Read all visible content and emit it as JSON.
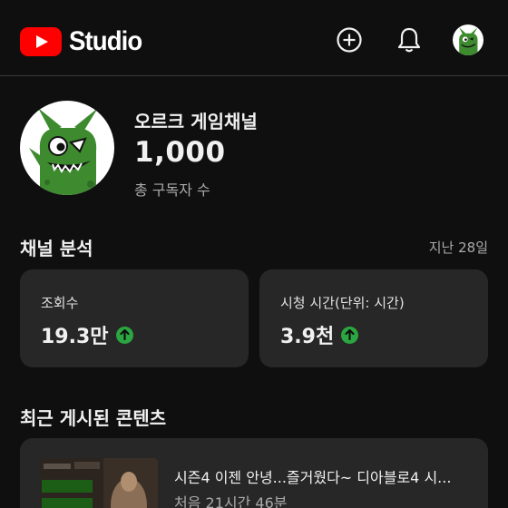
{
  "app": {
    "logo_text": "Studio",
    "icons": [
      "create-icon",
      "bell-icon",
      "account-avatar"
    ]
  },
  "channel": {
    "name": "오르크 게임채널",
    "subscriber_count": "1,000",
    "subscriber_label": "총 구독자 수"
  },
  "analytics": {
    "title": "채널 분석",
    "period": "지난 28일",
    "cards": [
      {
        "label": "조회수",
        "value": "19.3만",
        "trend": "up"
      },
      {
        "label": "시청 시간(단위: 시간)",
        "value": "3.9천",
        "trend": "up"
      }
    ]
  },
  "recent": {
    "title": "최근 게시된 콘텐츠",
    "video": {
      "title": "시즌4 이젠 안녕...즐거웠다~ 디아블로4 시...",
      "meta": "처음 21시간 46분"
    }
  },
  "colors": {
    "background": "#0f0f0f",
    "card": "#272727",
    "brand_red": "#ff0000",
    "trend_green": "#2ba640",
    "mascot_green": "#3d8a2f"
  }
}
